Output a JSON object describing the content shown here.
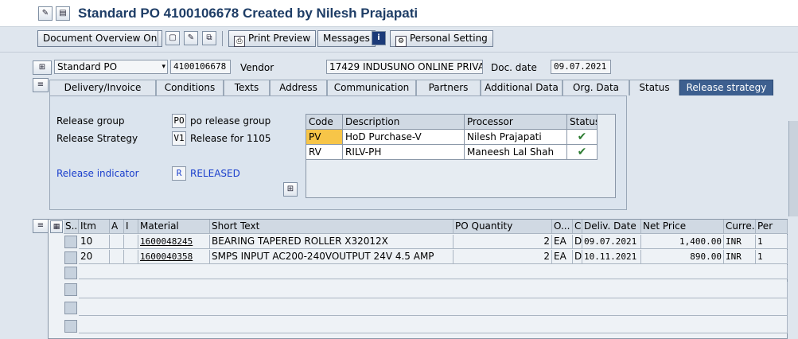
{
  "title": "Standard PO 4100106678 Created by Nilesh Prajapati",
  "toolbar": {
    "doc_overview": "Document Overview On",
    "print_preview": "Print Preview",
    "messages": "Messages",
    "personal_setting": "Personal Setting"
  },
  "header": {
    "doc_type": "Standard PO",
    "po_number": "4100106678",
    "vendor_label": "Vendor",
    "vendor_value": "17429 INDUSUNO ONLINE PRIVA...",
    "doc_date_label": "Doc. date",
    "doc_date_value": "09.07.2021"
  },
  "tabs": [
    {
      "label": "Delivery/Invoice"
    },
    {
      "label": "Conditions"
    },
    {
      "label": "Texts"
    },
    {
      "label": "Address"
    },
    {
      "label": "Communication"
    },
    {
      "label": "Partners"
    },
    {
      "label": "Additional Data"
    },
    {
      "label": "Org. Data"
    },
    {
      "label": "Status"
    },
    {
      "label": "Release strategy"
    }
  ],
  "release": {
    "group_label": "Release group",
    "group_code": "PO",
    "group_desc": "po release group",
    "strategy_label": "Release Strategy",
    "strategy_code": "V1",
    "strategy_desc": "Release for 1105",
    "indicator_label": "Release indicator",
    "indicator_code": "R",
    "indicator_desc": "RELEASED",
    "table_headers": {
      "code": "Code",
      "description": "Description",
      "processor": "Processor",
      "status": "Status"
    },
    "rows": [
      {
        "code": "PV",
        "description": "HoD Purchase-V",
        "processor": "Nilesh Prajapati",
        "status": "✔"
      },
      {
        "code": "RV",
        "description": "RILV-PH",
        "processor": "Maneesh Lal Shah",
        "status": "✔"
      }
    ]
  },
  "items": {
    "headers": {
      "s": "S..",
      "itm": "Itm",
      "a": "A",
      "i": "I",
      "material": "Material",
      "short_text": "Short Text",
      "po_qty": "PO Quantity",
      "o": "O...",
      "c": "C",
      "deliv_date": "Deliv. Date",
      "net_price": "Net Price",
      "curr": "Curre...",
      "per": "Per"
    },
    "rows": [
      {
        "itm": "10",
        "material": "1600048245",
        "short_text": "BEARING TAPERED ROLLER X32012X",
        "qty": "2",
        "uom": "EA",
        "c": "D",
        "deliv_date": "09.07.2021",
        "net_price": "1,400.00",
        "curr": "INR",
        "per": "1"
      },
      {
        "itm": "20",
        "material": "1600040358",
        "short_text": "SMPS INPUT AC200-240VOUTPUT 24V 4.5 AMP",
        "qty": "2",
        "uom": "EA",
        "c": "D",
        "deliv_date": "10.11.2021",
        "net_price": "890.00",
        "curr": "INR",
        "per": "1"
      }
    ]
  }
}
